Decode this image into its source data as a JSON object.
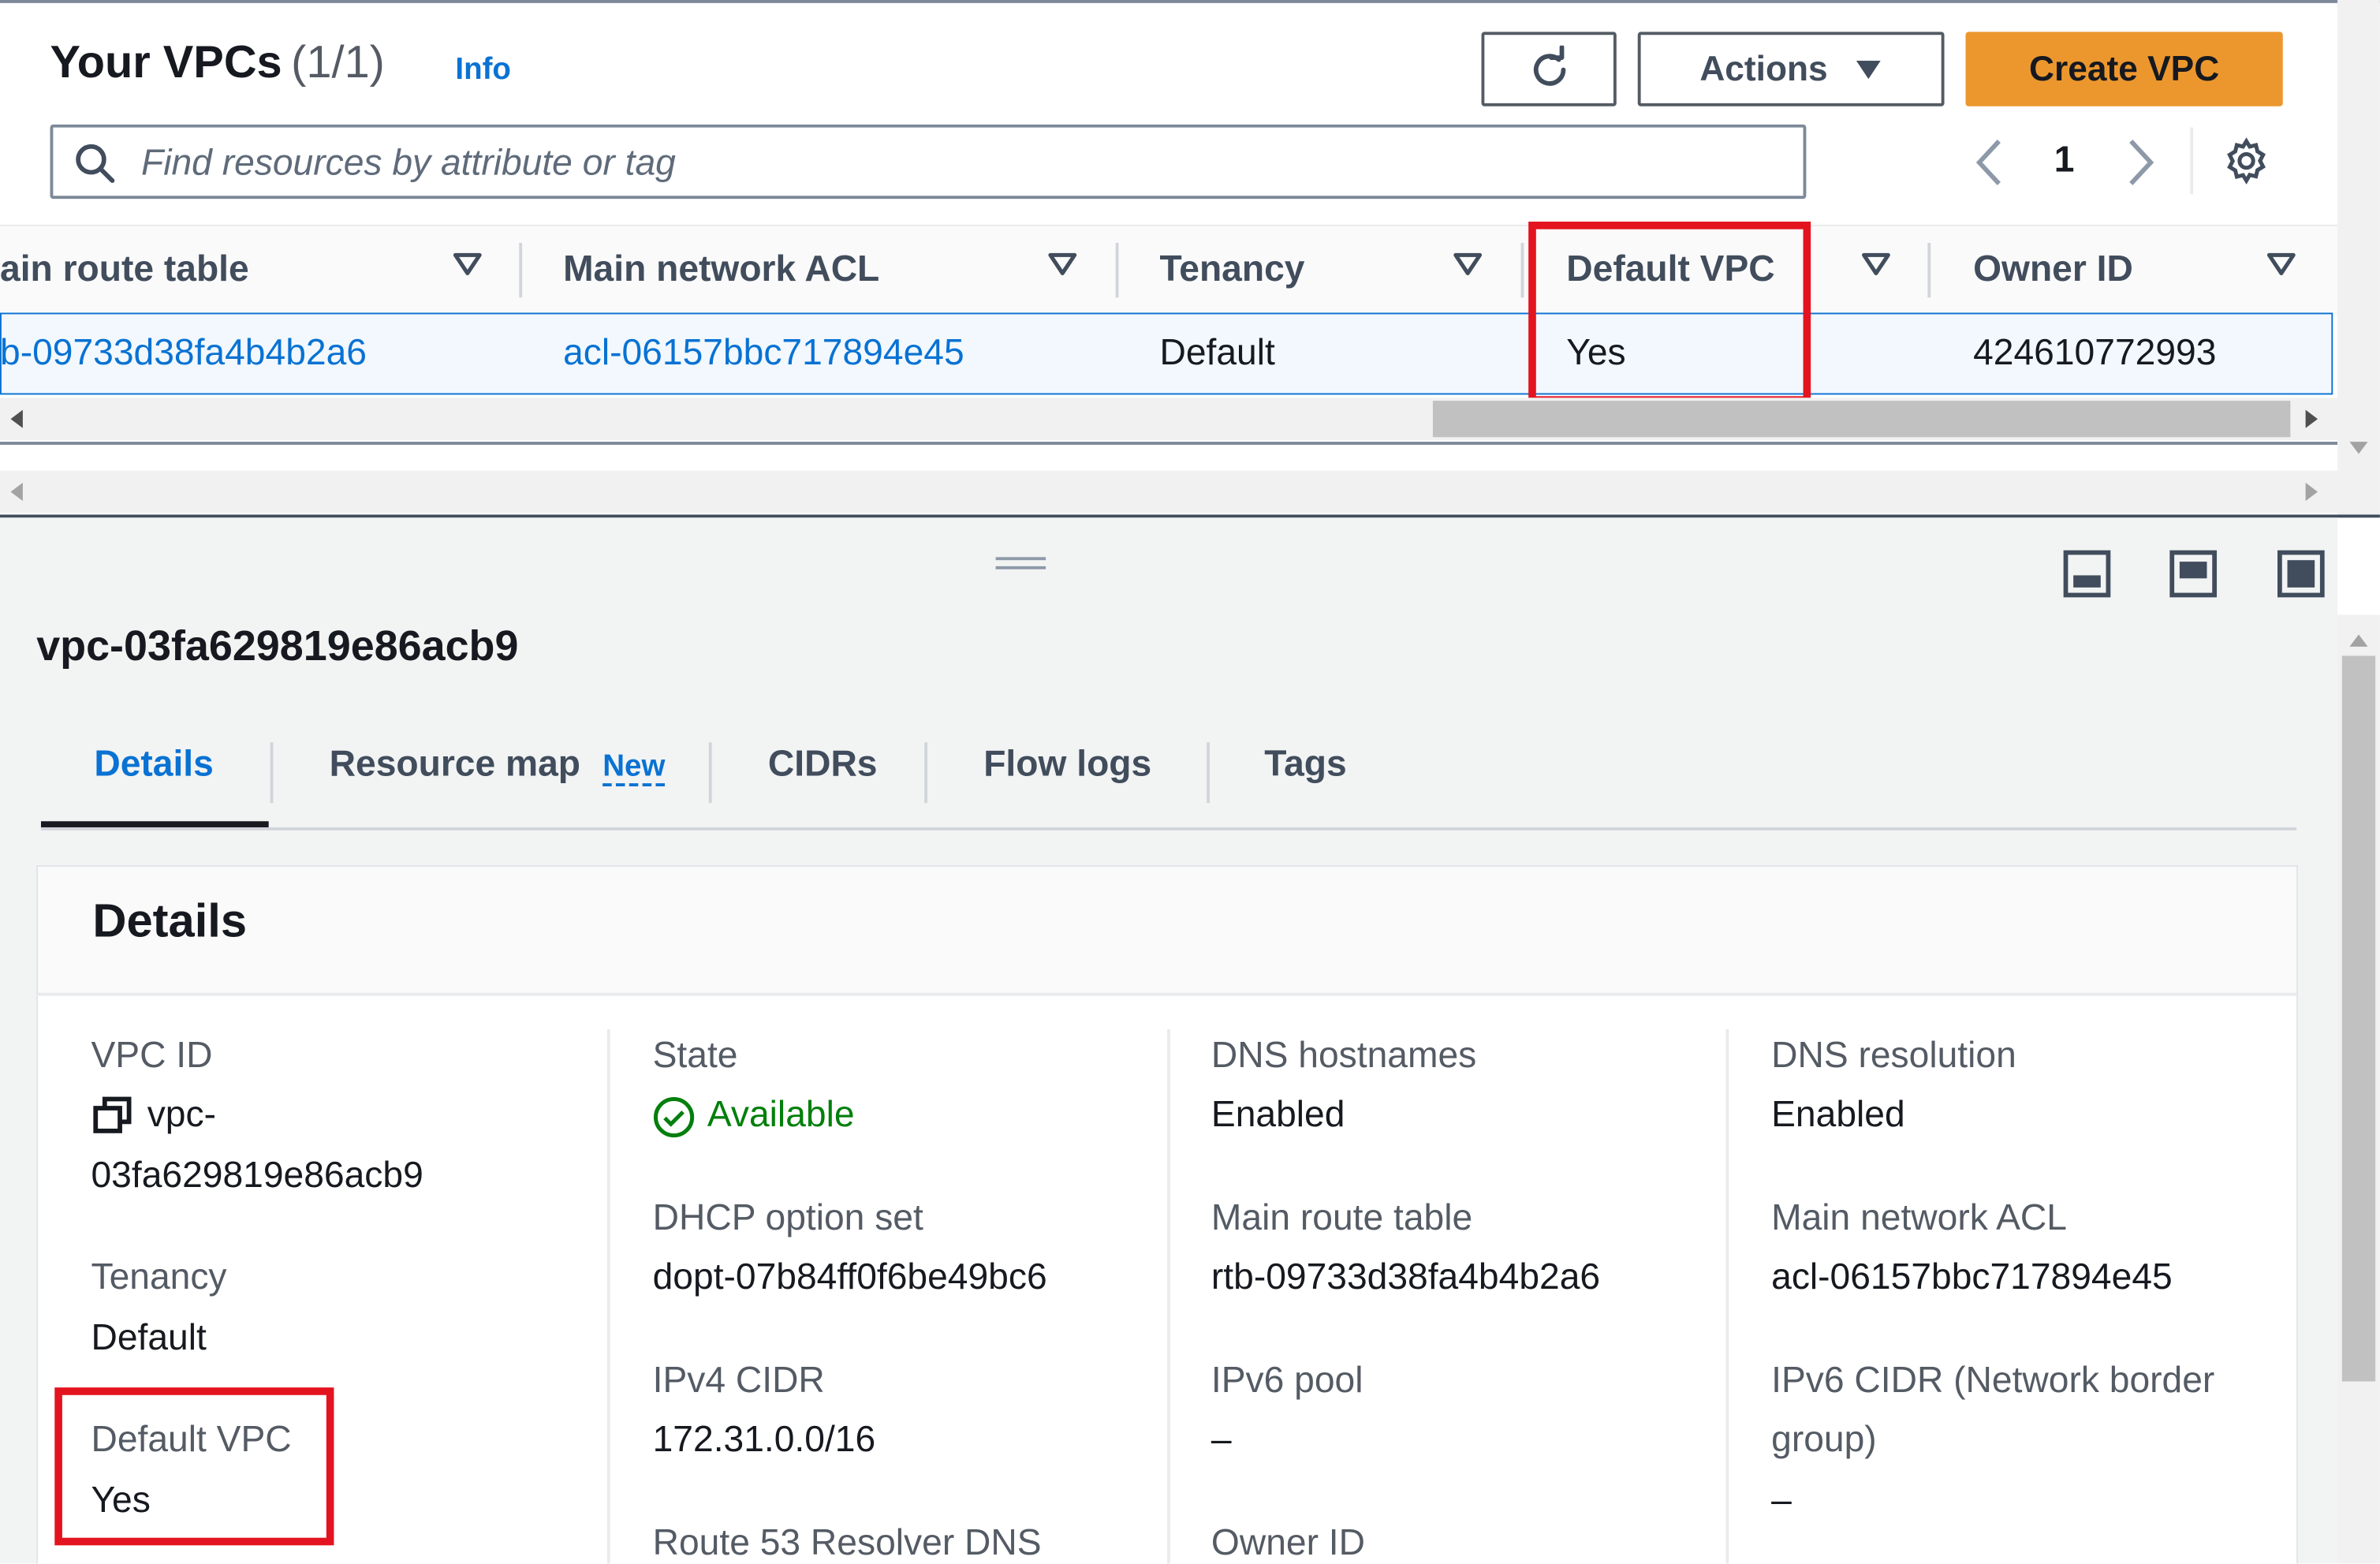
{
  "header": {
    "title": "Your VPCs",
    "count": "(1/1)",
    "info_label": "Info",
    "actions_label": "Actions",
    "create_label": "Create VPC"
  },
  "search": {
    "placeholder": "Find resources by attribute or tag"
  },
  "pagination": {
    "page": "1"
  },
  "table": {
    "columns": [
      "ain route table",
      "Main network ACL",
      "Tenancy",
      "Default VPC",
      "Owner ID"
    ],
    "row": {
      "route_table": "b-09733d38fa4b4b2a6",
      "network_acl": "acl-06157bbc717894e45",
      "tenancy": "Default",
      "default_vpc": "Yes",
      "owner_id": "424610772993"
    }
  },
  "detail": {
    "vpc_heading": "vpc-03fa629819e86acb9",
    "tabs": [
      "Details",
      "Resource map",
      "CIDRs",
      "Flow logs",
      "Tags"
    ],
    "new_badge": "New",
    "section_title": "Details",
    "fields": {
      "vpc_id_label": "VPC ID",
      "vpc_id_line1": "vpc-",
      "vpc_id_line2": "03fa629819e86acb9",
      "tenancy_label": "Tenancy",
      "tenancy_value": "Default",
      "default_vpc_label": "Default VPC",
      "default_vpc_value": "Yes",
      "state_label": "State",
      "state_value": "Available",
      "dhcp_label": "DHCP option set",
      "dhcp_value": "dopt-07b84ff0f6be49bc6",
      "ipv4_label": "IPv4 CIDR",
      "ipv4_value": "172.31.0.0/16",
      "route53_label": "Route 53 Resolver DNS",
      "dns_hostnames_label": "DNS hostnames",
      "dns_hostnames_value": "Enabled",
      "main_route_label": "Main route table",
      "main_route_value": "rtb-09733d38fa4b4b2a6",
      "ipv6_pool_label": "IPv6 pool",
      "ipv6_pool_value": "–",
      "owner_label": "Owner ID",
      "dns_resolution_label": "DNS resolution",
      "dns_resolution_value": "Enabled",
      "main_acl_label": "Main network ACL",
      "main_acl_value": "acl-06157bbc717894e45",
      "ipv6_cidr_label_1": "IPv6 CIDR (Network border",
      "ipv6_cidr_label_2": "group)",
      "ipv6_cidr_value": "–"
    }
  },
  "colors": {
    "link": "#0972d3",
    "primary_button": "#ec972e",
    "highlight_box": "#e3141f",
    "success": "#037f0c"
  }
}
